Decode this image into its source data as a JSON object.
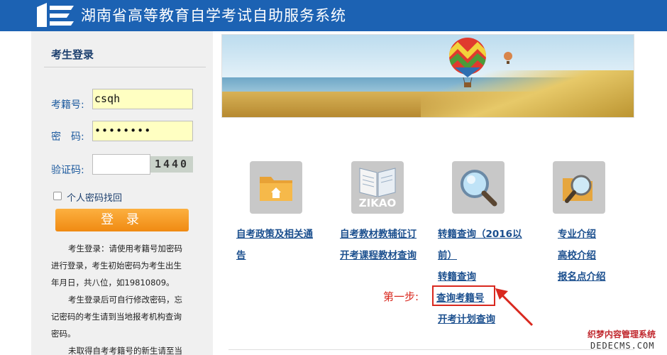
{
  "header": {
    "title": "湖南省高等教育自学考试自助服务系统"
  },
  "login": {
    "title": "考生登录",
    "id_label": "考籍号:",
    "id_value": "csqh",
    "pwd_label": "密　码:",
    "pwd_value": "••••••••",
    "captcha_label": "验证码:",
    "captcha_code": "1440",
    "remember_label": "个人密码找回",
    "login_button": "登 录",
    "notes": [
      "考生登录：请使用考籍号加密码",
      "进行登录，考生初始密码为考生出生",
      "年月日，共八位，如19810809。",
      "考生登录后可自行修改密码，忘",
      "记密码的考生请到当地报考机构查询",
      "密码。",
      "未取得自考考籍号的新生请至当"
    ]
  },
  "icons": [
    {
      "name": "folder-home-icon"
    },
    {
      "name": "zikao-book-icon",
      "text": "ZIKAO"
    },
    {
      "name": "magnifier-icon"
    },
    {
      "name": "search-folder-icon"
    }
  ],
  "links": {
    "col1": [
      "自考政策及相关通",
      "告"
    ],
    "col2": [
      "自考教材教辅征订",
      "开考课程教材查询"
    ],
    "col3": [
      "转籍查询（2016以",
      "前）",
      "转籍查询",
      "查询考籍号",
      "开考计划查询"
    ],
    "col4": [
      "专业介绍",
      "高校介绍",
      "报名点介绍"
    ]
  },
  "step_label": "第一步:",
  "watermark": {
    "line1": "织梦内容管理系统",
    "line2": "DEDECMS.COM"
  },
  "colors": {
    "header": "#1c62b3",
    "link": "#1b4f8e",
    "accent_red": "#d9281e",
    "button_orange": "#f08a12"
  }
}
